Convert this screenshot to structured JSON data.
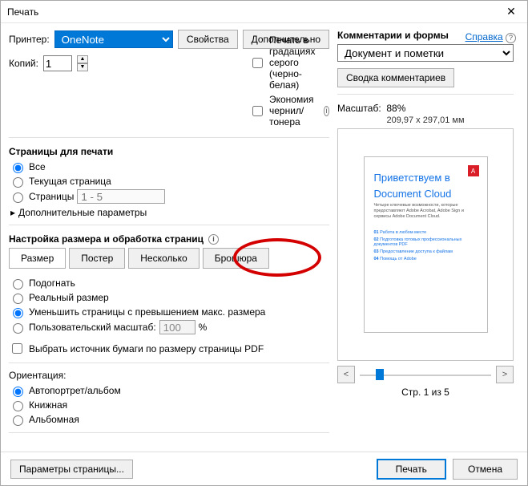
{
  "title": "Печать",
  "help": "Справка",
  "printer": {
    "label": "Принтер:",
    "value": "OneNote"
  },
  "buttons": {
    "properties": "Свойства",
    "advanced": "Дополнительно",
    "summarize": "Сводка комментариев",
    "page_setup": "Параметры страницы...",
    "print": "Печать",
    "cancel": "Отмена"
  },
  "copies": {
    "label": "Копий:",
    "value": "1"
  },
  "checkboxes": {
    "grayscale": "Печать в градациях серого (черно-белая)",
    "ink_save": "Экономия чернил/тонера",
    "more_params": "Дополнительные параметры",
    "paper_source": "Выбрать источник бумаги по размеру страницы PDF"
  },
  "pages_group": {
    "title": "Страницы для печати",
    "all": "Все",
    "current": "Текущая страница",
    "pages": "Страницы",
    "range_placeholder": "1 - 5"
  },
  "sizing_group": {
    "title": "Настройка размера и обработка страниц",
    "tabs": {
      "size": "Размер",
      "poster": "Постер",
      "multiple": "Несколько",
      "booklet": "Брошюра"
    },
    "fit": "Подогнать",
    "actual": "Реальный размер",
    "shrink": "Уменьшить страницы с превышением макс. размера",
    "custom": "Пользовательский масштаб:",
    "custom_value": "100",
    "custom_unit": "%"
  },
  "orientation": {
    "title": "Ориентация:",
    "auto": "Автопортрет/альбом",
    "portrait": "Книжная",
    "landscape": "Альбомная"
  },
  "comments": {
    "title": "Комментарии и формы",
    "value": "Документ и пометки"
  },
  "preview": {
    "scale_label": "Масштаб:",
    "scale_value": "88%",
    "dimensions": "209,97 x 297,01 мм",
    "doc_title1": "Приветствуем в",
    "doc_title2": "Document Cloud",
    "doc_sub": "Четыре ключевые возможности, которые предоставляют Adobe Acrobat, Adobe Sign и сервисы Adobe Document Cloud.",
    "items": [
      "Работа в любом месте",
      "Подготовка готовых профессиональных документов PDF",
      "Предоставление доступа к файлам",
      "Помощь от Adobe"
    ],
    "page_counter": "Стр. 1 из 5"
  }
}
